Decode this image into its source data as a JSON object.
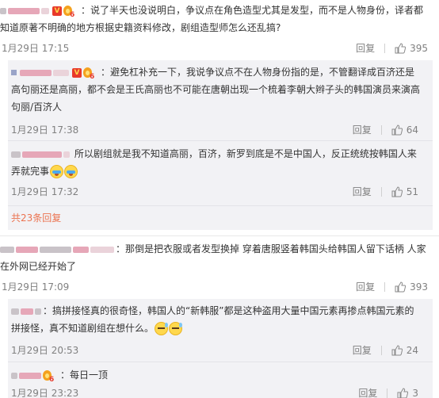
{
  "comments": [
    {
      "text": "说了半天也没说明白，争议点在角色造型尤其是发型，而不是人物身份，译者都知道原著不明确的地方根据史籍资料修改，剧组造型师怎么还乱搞?",
      "time": "1月29日 17:15",
      "reply_label": "回复",
      "likes": "395"
    },
    {
      "text": "避免杠补充一下，我说争议点不在人物身份指的是，不管翻译成百济还是高句丽还是高丽，都不会是王氏高丽也不可能在唐朝出现一个梳着李朝大辫子头的韩国演员来演高句丽/百济人",
      "time": "1月29日 17:38",
      "reply_label": "回复",
      "likes": "64"
    },
    {
      "text": "所以剧组就是我不知道高丽，百济，新罗到底是不是中国人，反正统统按韩国人来弄就完事",
      "time": "1月29日 17:32",
      "reply_label": "回复",
      "likes": "51"
    },
    {
      "text": "那倒是把衣服或者发型换掉 穿着唐服竖着韩国头给韩国人留下话柄 人家在外网已经开始了",
      "time": "1月29日 17:09",
      "reply_label": "回复",
      "likes": "393"
    },
    {
      "text": "搞拼接怪真的很奇怪，韩国人的“新韩服”都是这种盗用大量中国元素再掺点韩国元素的拼接怪，真不知道剧组在想什么。",
      "time": "1月29日 20:53",
      "reply_label": "回复",
      "likes": "24"
    },
    {
      "text": "每日一顶",
      "time": "1月29日 23:23",
      "reply_label": "回复",
      "likes": "3"
    }
  ],
  "more_replies": "共23条回复",
  "badges": {
    "verified": "V",
    "fan_level": "6"
  },
  "colors": {
    "accent": "#eb7350",
    "reply_bg": "#f2f2f5",
    "meta": "#808080"
  },
  "icons": {
    "like": "thumbs-up-icon",
    "emoji_cry": "crying-emoji-icon",
    "emoji_sweat": "sweat-emoji-icon"
  }
}
